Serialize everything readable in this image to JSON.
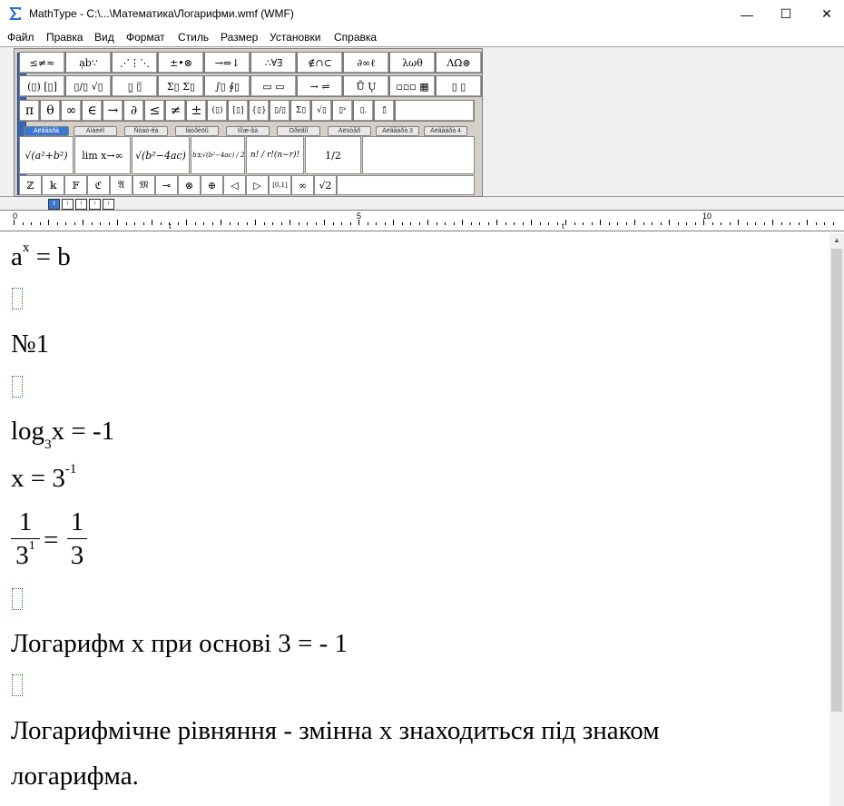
{
  "window": {
    "title": "MathType - C:\\...\\Математика\\Логарифми.wmf (WMF)",
    "minimize": "—",
    "maximize": "☐",
    "close": "✕"
  },
  "menu": [
    "Файл",
    "Правка",
    "Вид",
    "Формат",
    "Стиль",
    "Размер",
    "Установки",
    "Справка"
  ],
  "toolbar": {
    "palette_row1": [
      "≤≠≈",
      "ạb∵",
      "⋰⋮⋱",
      "±•⊗",
      "→⇔↓",
      "∴∀∃",
      "∉∩⊂",
      "∂∞ℓ",
      "λωθ",
      "ΛΩ⊛"
    ],
    "palette_row2": [
      "(▯) [▯]",
      "▯/▯ √▯",
      "▯̲ ▯̅",
      "Σ▯ Σ▯",
      "∫▯ ∮▯",
      "▭ ▭",
      "→ ⇌",
      "Ů Ų",
      "▫▫▫ ▦",
      "▯ ▯"
    ],
    "symbols": [
      "π",
      "θ",
      "∞",
      "∈",
      "→",
      "∂",
      "≤",
      "≠",
      "±",
      "(▯)",
      "[▯]",
      "{▯}",
      "▯/▯",
      "Σ▯",
      "√▯",
      "▯ˣ",
      "▯.",
      "▯̃"
    ],
    "tabs": [
      "Àëãåáðà",
      "Àìáèèî",
      "Ñòàò-êà",
      "Ìàòðèöû",
      "Ìíîæ-âà",
      "Òðèãîí",
      "Àëüòåð",
      "Àëãåáðà 3",
      "Àëãåáðà 4"
    ],
    "templates": [
      "√(a²+b²)",
      "lim x→∞",
      "√(b²−4ac)",
      "−b±√(b²−4ac) / 2a",
      "n! / r!(n−r)!",
      "1/2"
    ],
    "small_symbols": [
      "ℤ",
      "𝕜",
      "𝔽",
      "ℭ",
      "𝔄",
      "𝔐",
      "⊸",
      "⊗",
      "⊕",
      "◁",
      "▷",
      "[0,1]",
      "∞",
      "√2"
    ],
    "size_buttons": [
      "t",
      "↑",
      "↑",
      "↑",
      "↑"
    ]
  },
  "ruler": {
    "labels": [
      "0",
      "5",
      "10"
    ],
    "tab_marks": [
      "t",
      "t"
    ]
  },
  "scrollbar": {
    "up_arrow": "▲"
  },
  "document": {
    "line1": {
      "base": "a",
      "sup": "x",
      "rest": " = b"
    },
    "line2": "№1",
    "line3": {
      "log": "log",
      "sub": "3",
      "rest": "x = -1"
    },
    "line4": {
      "pre": "x = 3",
      "sup": "-1"
    },
    "frac1": {
      "num": "1",
      "den_base": "3",
      "den_sup": "1"
    },
    "equals": "=",
    "frac2": {
      "num": "1",
      "den": "3"
    },
    "sentence1": "Логарифм x при основі 3  = - 1",
    "sentence2_line1": "Логарифмічне рівняння - змінна x знаходиться під знаком",
    "sentence2_line2": "логарифма."
  }
}
